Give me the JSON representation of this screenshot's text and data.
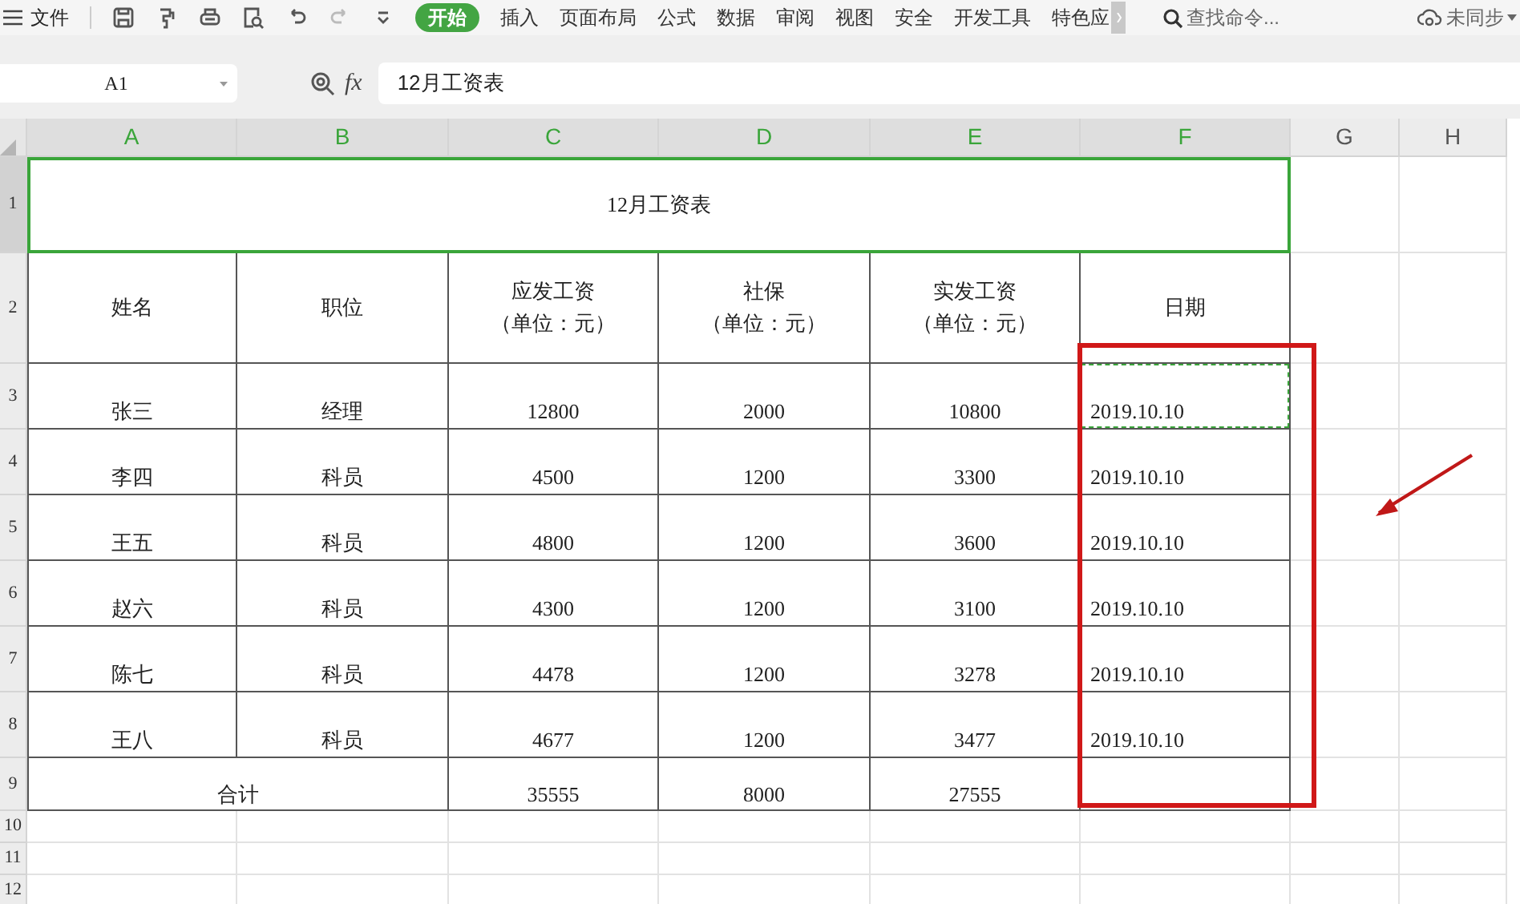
{
  "menu": {
    "file": "文件",
    "tabs": [
      {
        "label": "开始",
        "selected": true
      },
      {
        "label": "插入",
        "selected": false
      },
      {
        "label": "页面布局",
        "selected": false
      },
      {
        "label": "公式",
        "selected": false
      },
      {
        "label": "数据",
        "selected": false
      },
      {
        "label": "审阅",
        "selected": false
      },
      {
        "label": "视图",
        "selected": false
      },
      {
        "label": "安全",
        "selected": false
      },
      {
        "label": "开发工具",
        "selected": false
      },
      {
        "label": "特色应",
        "selected": false
      }
    ],
    "search_placeholder": "查找命令...",
    "sync": "未同步"
  },
  "formula_bar": {
    "name_box": "A1",
    "fx": "fx",
    "value": "12月工资表"
  },
  "columns": [
    {
      "label": "A",
      "selected": true
    },
    {
      "label": "B",
      "selected": true
    },
    {
      "label": "C",
      "selected": true
    },
    {
      "label": "D",
      "selected": true
    },
    {
      "label": "E",
      "selected": true
    },
    {
      "label": "F",
      "selected": true
    },
    {
      "label": "G",
      "selected": false
    },
    {
      "label": "H",
      "selected": false
    }
  ],
  "row_numbers": [
    {
      "label": "1",
      "selected": true
    },
    {
      "label": "2",
      "selected": false
    },
    {
      "label": "3",
      "selected": false
    },
    {
      "label": "4",
      "selected": false
    },
    {
      "label": "5",
      "selected": false
    },
    {
      "label": "6",
      "selected": false
    },
    {
      "label": "7",
      "selected": false
    },
    {
      "label": "8",
      "selected": false
    },
    {
      "label": "9",
      "selected": false
    },
    {
      "label": "10",
      "selected": false
    },
    {
      "label": "11",
      "selected": false
    },
    {
      "label": "12",
      "selected": false
    }
  ],
  "sheet": {
    "title": "12月工资表",
    "headers": [
      [
        "姓名"
      ],
      [
        "职位"
      ],
      [
        "应发工资",
        "（单位：元）"
      ],
      [
        "社保",
        "（单位：元）"
      ],
      [
        "实发工资",
        "（单位：元）"
      ],
      [
        "日期"
      ]
    ],
    "rows": [
      {
        "cells": [
          "张三",
          "经理",
          "12800",
          "2000",
          "10800",
          "2019.10.10"
        ],
        "copy_marquee": true
      },
      {
        "cells": [
          "李四",
          "科员",
          "4500",
          "1200",
          "3300",
          "2019.10.10"
        ],
        "copy_marquee": false
      },
      {
        "cells": [
          "王五",
          "科员",
          "4800",
          "1200",
          "3600",
          "2019.10.10"
        ],
        "copy_marquee": false
      },
      {
        "cells": [
          "赵六",
          "科员",
          "4300",
          "1200",
          "3100",
          "2019.10.10"
        ],
        "copy_marquee": false
      },
      {
        "cells": [
          "陈七",
          "科员",
          "4478",
          "1200",
          "3278",
          "2019.10.10"
        ],
        "copy_marquee": false
      },
      {
        "cells": [
          "王八",
          "科员",
          "4677",
          "1200",
          "3477",
          "2019.10.10"
        ],
        "copy_marquee": false
      }
    ],
    "total": {
      "label": "合计",
      "values": [
        "35555",
        "8000",
        "27555"
      ]
    }
  }
}
